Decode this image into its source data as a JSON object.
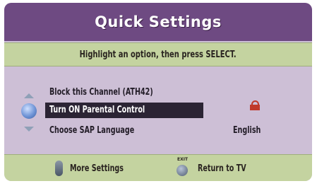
{
  "title": "Quick Settings",
  "instruction": "Highlight an option, then press SELECT.",
  "menu": {
    "items": [
      {
        "label": "Block this Channel (ATH42)",
        "value": ""
      },
      {
        "label": "Turn ON Parental Control",
        "value": ""
      },
      {
        "label": "Choose SAP Language",
        "value": "English"
      }
    ],
    "selected_index": 1
  },
  "icons": {
    "lock": "lock-open-icon",
    "nav": "up-down-select-icon"
  },
  "footer": {
    "more_settings": "More Settings",
    "exit_label": "EXIT",
    "return_to_tv": "Return to TV"
  },
  "colors": {
    "title_bar": "#6e4a82",
    "instruction_bar": "#c4d3a0",
    "body": "#cdbfd6",
    "selected_bg": "#2b2434",
    "lock": "#c0392b"
  }
}
